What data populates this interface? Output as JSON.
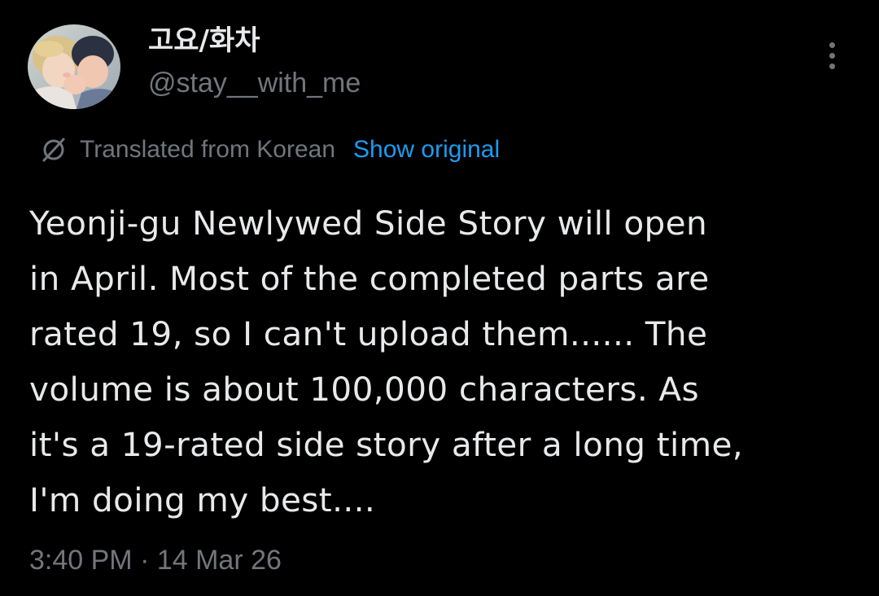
{
  "author": {
    "display_name": "고요/화차",
    "handle": "@stay__with_me"
  },
  "translation": {
    "label": "Translated from Korean",
    "show_original_label": "Show original",
    "icon": "translate-icon"
  },
  "tweet": {
    "text": "Yeonji-gu Newlywed Side Story will open\nin April. Most of the completed parts are\nrated 19, so I can't upload them...... The\nvolume is about 100,000 characters. As\nit's a 19-rated side story after a long time,\nI'm doing my best....",
    "timestamp": "3:40 PM · 14 Mar 26"
  },
  "colors": {
    "background": "#000000",
    "primary_text": "#e7e9ea",
    "secondary_text": "#71767b",
    "accent": "#1d9bf0"
  },
  "icons": {
    "more": "more-vertical-icon"
  }
}
